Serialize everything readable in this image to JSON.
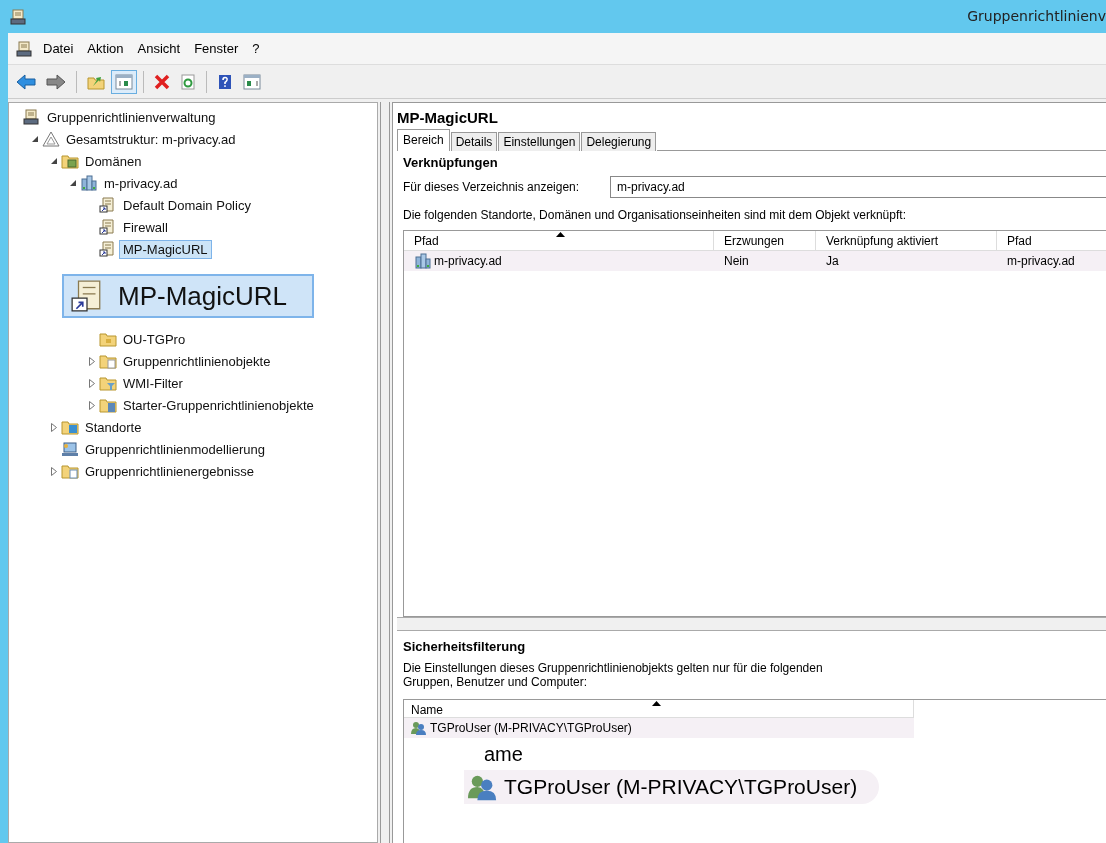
{
  "window": {
    "title": "Gruppenrichtlinienv"
  },
  "menu": [
    {
      "label": "Datei"
    },
    {
      "label": "Aktion"
    },
    {
      "label": "Ansicht"
    },
    {
      "label": "Fenster"
    },
    {
      "label": "?"
    }
  ],
  "toolbar": [
    {
      "kind": "back"
    },
    {
      "kind": "forward"
    },
    {
      "kind": "sep"
    },
    {
      "kind": "up"
    },
    {
      "kind": "tree",
      "selected": true
    },
    {
      "kind": "sep"
    },
    {
      "kind": "delete"
    },
    {
      "kind": "refresh"
    },
    {
      "kind": "sep"
    },
    {
      "kind": "help"
    },
    {
      "kind": "pane"
    }
  ],
  "tree": [
    {
      "kind": "root",
      "label": "Gruppenrichtlinienverwaltung",
      "selected": false,
      "children": [
        {
          "kind": "forest",
          "label": "Gesamtstruktur: m-privacy.ad",
          "selected": false,
          "expanded": true,
          "children": [
            {
              "kind": "container",
              "label": "Domänen",
              "selected": false,
              "expanded": true,
              "children": [
                {
                  "kind": "domain",
                  "label": "m-privacy.ad",
                  "selected": false,
                  "expanded": true,
                  "children": [
                    {
                      "kind": "gpo_link",
                      "label": "Default Domain Policy",
                      "selected": false
                    },
                    {
                      "kind": "gpo_link",
                      "label": "Firewall",
                      "selected": false
                    },
                    {
                      "kind": "gpo_link",
                      "label": "MP-MagicURL",
                      "selected": true
                    },
                    {
                      "kind": "magnified",
                      "label": "MP-MagicURL",
                      "selected": true
                    },
                    {
                      "kind": "ou",
                      "label": "OU-TGPro",
                      "selected": false
                    },
                    {
                      "kind": "folder",
                      "label": "Gruppenrichtlinienobjekte",
                      "selected": false,
                      "expanded": false
                    },
                    {
                      "kind": "filter",
                      "label": "WMI-Filter",
                      "selected": false,
                      "expanded": false
                    },
                    {
                      "kind": "starter",
                      "label": "Starter-Gruppenrichtlinienobjekte",
                      "selected": false,
                      "expanded": false
                    }
                  ]
                }
              ]
            },
            {
              "kind": "sites",
              "label": "Standorte",
              "selected": false,
              "expanded": false
            },
            {
              "kind": "modeling",
              "label": "Gruppenrichtlinienmodellierung",
              "selected": false
            },
            {
              "kind": "results",
              "label": "Gruppenrichtlinienergebnisse",
              "selected": false,
              "expanded": false
            }
          ]
        }
      ]
    }
  ],
  "details": {
    "title": "MP-MagicURL",
    "tabs": [
      {
        "label": "Bereich",
        "selected": true
      },
      {
        "label": "Details",
        "selected": false
      },
      {
        "label": "Einstellungen",
        "selected": false
      },
      {
        "label": "Delegierung",
        "selected": false
      }
    ],
    "links": {
      "heading": "Verknüpfungen",
      "directory_label": "Für dieses Verzeichnis anzeigen:",
      "directory_value": "m-privacy.ad",
      "description": "Die folgenden Standorte, Domänen und Organisationseinheiten sind mit dem Objekt verknüpft:",
      "columns": [
        {
          "label": "Pfad",
          "sorted": true
        },
        {
          "label": "Erzwungen",
          "sorted": false
        },
        {
          "label": "Verknüpfung aktiviert",
          "sorted": false
        },
        {
          "label": "Pfad",
          "sorted": false
        }
      ],
      "rows": [
        {
          "cells": [
            "m-privacy.ad",
            "Nein",
            "Ja",
            "m-privacy.ad"
          ]
        }
      ]
    },
    "security_filtering": {
      "heading": "Sicherheitsfilterung",
      "description": "Die Einstellungen dieses Gruppenrichtlinienobjekts gelten nur für die folgenden Gruppen, Benutzer und Computer:",
      "columns": [
        {
          "label": "Name",
          "sorted": true
        }
      ],
      "rows": [
        {
          "name": "TGProUser (M-PRIVACY\\TGProUser)"
        }
      ],
      "magnified_header_fragment": "ame",
      "magnified_row": "TGProUser (M-PRIVACY\\TGProUser)"
    }
  }
}
